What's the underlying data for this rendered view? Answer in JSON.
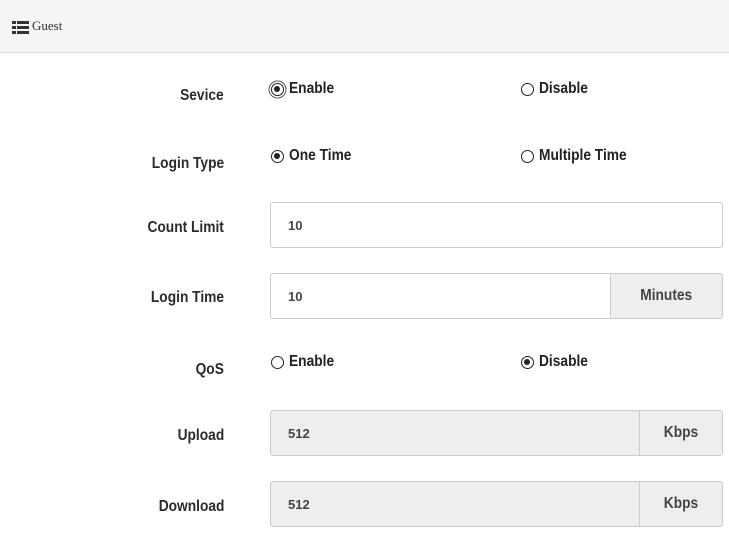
{
  "header": {
    "title": "Guest",
    "icon": "list-icon"
  },
  "form": {
    "service": {
      "label": "Sevice",
      "options": [
        "Enable",
        "Disable"
      ],
      "selected": "Enable"
    },
    "login_type": {
      "label": "Login Type",
      "options": [
        "One Time",
        "Multiple Time"
      ],
      "selected": "One Time"
    },
    "count_limit": {
      "label": "Count Limit",
      "value": "10"
    },
    "login_time": {
      "label": "Login Time",
      "value": "10",
      "unit": "Minutes"
    },
    "qos": {
      "label": "QoS",
      "options": [
        "Enable",
        "Disable"
      ],
      "selected": "Disable"
    },
    "upload": {
      "label": "Upload",
      "value": "512",
      "unit": "Kbps"
    },
    "download": {
      "label": "Download",
      "value": "512",
      "unit": "Kbps"
    }
  }
}
